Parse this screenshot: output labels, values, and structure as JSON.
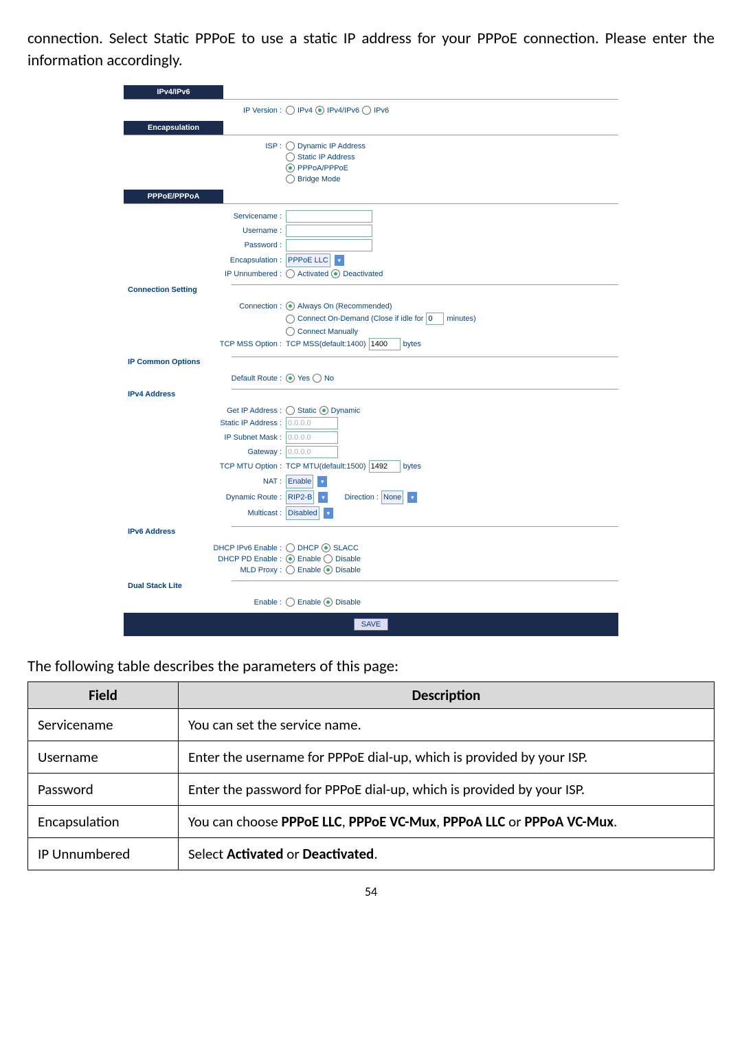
{
  "intro": "connection. Select Static PPPoE to use a static IP address for your PPPoE connection. Please enter the information accordingly.",
  "sections": {
    "ipv4ipv6": {
      "header": "IPv4/IPv6",
      "ipversion_label": "IP Version :",
      "options": {
        "ipv4": "IPv4",
        "both": "IPv4/IPv6",
        "ipv6": "IPv6"
      }
    },
    "encapsulation": {
      "header": "Encapsulation",
      "isp_label": "ISP :",
      "options": {
        "dynamic": "Dynamic IP Address",
        "static": "Static IP Address",
        "pppoa": "PPPoA/PPPoE",
        "bridge": "Bridge Mode"
      }
    },
    "pppoe": {
      "header": "PPPoE/PPPoA",
      "servicename": "Servicename :",
      "username": "Username :",
      "password": "Password :",
      "encap": "Encapsulation :",
      "encap_value": "PPPoE LLC",
      "ipun": "IP Unnumbered :",
      "activated": "Activated",
      "deactivated": "Deactivated"
    },
    "connection": {
      "header": "Connection Setting",
      "conn_label": "Connection :",
      "always": "Always On (Recommended)",
      "ondemand_pre": "Connect On-Demand (Close if idle for",
      "ondemand_val": "0",
      "ondemand_post": "minutes)",
      "manual": "Connect Manually",
      "tcpmss_label": "TCP MSS Option :",
      "tcpmss_pre": "TCP MSS(default:1400)",
      "tcpmss_val": "1400",
      "bytes": "bytes"
    },
    "ipcommon": {
      "header": "IP Common Options",
      "defroute_label": "Default Route :",
      "yes": "Yes",
      "no": "No"
    },
    "ipv4addr": {
      "header": "IPv4 Address",
      "getip_label": "Get IP Address :",
      "static": "Static",
      "dynamic": "Dynamic",
      "staticip_label": "Static IP Address :",
      "staticip_val": "0.0.0.0",
      "subnet_label": "IP Subnet Mask :",
      "subnet_val": "0.0.0.0",
      "gateway_label": "Gateway :",
      "gateway_val": "0.0.0.0",
      "tcpmtu_label": "TCP MTU Option :",
      "tcpmtu_pre": "TCP MTU(default:1500)",
      "tcpmtu_val": "1492",
      "nat_label": "NAT :",
      "nat_val": "Enable",
      "dynroute_label": "Dynamic Route :",
      "dynroute_val": "RIP2-B",
      "direction_label": "Direction :",
      "direction_val": "None",
      "multicast_label": "Multicast :",
      "multicast_val": "Disabled"
    },
    "ipv6addr": {
      "header": "IPv6 Address",
      "dhcpipv6_label": "DHCP IPv6 Enable :",
      "dhcp": "DHCP",
      "slacc": "SLACC",
      "dhcppd_label": "DHCP PD Enable :",
      "mldproxy_label": "MLD Proxy :",
      "enable": "Enable",
      "disable": "Disable"
    },
    "dualstack": {
      "header": "Dual Stack Lite",
      "enable_label": "Enable :",
      "enable": "Enable",
      "disable": "Disable"
    },
    "save": "SAVE"
  },
  "table_caption": "The following table describes the parameters of this page:",
  "table": {
    "headers": {
      "field": "Field",
      "desc": "Description"
    },
    "rows": [
      {
        "field": "Servicename",
        "desc": "You can set the service name."
      },
      {
        "field": "Username",
        "desc": "Enter the username for PPPoE dial-up, which is provided by your ISP."
      },
      {
        "field": "Password",
        "desc": "Enter the password for PPPoE dial-up, which is provided by your ISP."
      },
      {
        "field": "Encapsulation",
        "desc_pre": "You can choose ",
        "b1": "PPPoE LLC",
        "s1": ", ",
        "b2": "PPPoE VC-Mux",
        "s2": ", ",
        "b3": "PPPoA LLC",
        "s3": " or ",
        "b4": "PPPoA VC-Mux",
        "s4": "."
      },
      {
        "field": "IP Unnumbered",
        "desc_pre2": "Select ",
        "b5": "Activated",
        "s5": " or ",
        "b6": "Deactivated",
        "s6": "."
      }
    ]
  },
  "page_number": "54"
}
